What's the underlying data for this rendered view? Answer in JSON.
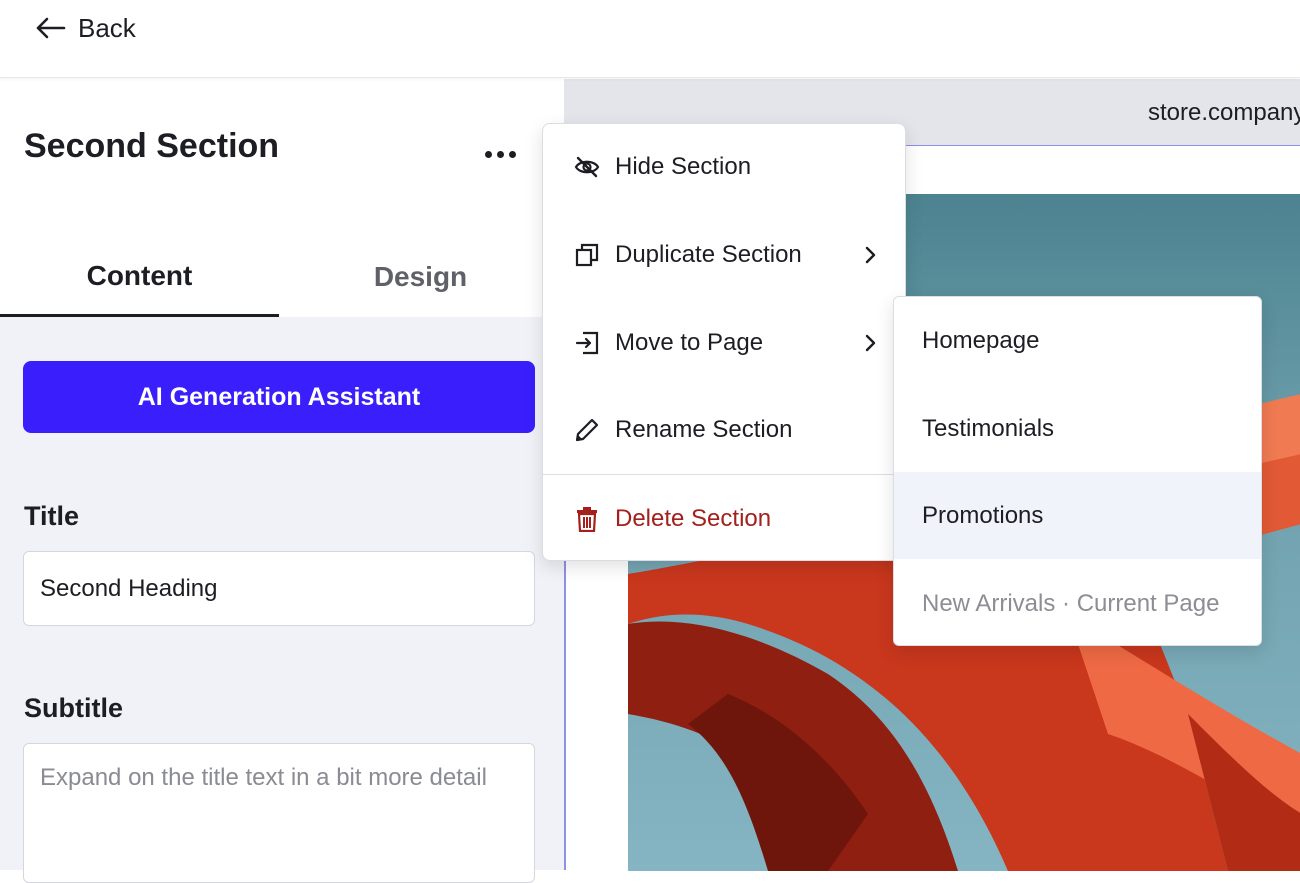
{
  "topbar": {
    "back_label": "Back"
  },
  "panel": {
    "section_title": "Second Section",
    "tabs": [
      {
        "label": "Content",
        "active": true
      },
      {
        "label": "Design",
        "active": false
      }
    ],
    "ai_button_label": "AI Generation Assistant",
    "title_label": "Title",
    "title_value": "Second Heading",
    "subtitle_label": "Subtitle",
    "subtitle_placeholder": "Expand on the title text in a bit more detail"
  },
  "preview": {
    "url": "store.company.com"
  },
  "menu": {
    "items": [
      {
        "label": "Hide Section",
        "icon": "eye-off-icon"
      },
      {
        "label": "Duplicate Section",
        "icon": "duplicate-icon",
        "has_submenu": true
      },
      {
        "label": "Move to Page",
        "icon": "move-to-page-icon",
        "has_submenu": true
      },
      {
        "label": "Rename Section",
        "icon": "pencil-icon"
      },
      {
        "label": "Delete Section",
        "icon": "trash-icon",
        "danger": true
      }
    ]
  },
  "submenu": {
    "items": [
      {
        "label": "Homepage"
      },
      {
        "label": "Testimonials"
      },
      {
        "label": "Promotions",
        "highlighted": true
      },
      {
        "label": "New Arrivals · Current Page",
        "disabled": true
      }
    ]
  },
  "colors": {
    "accent": "#3a1efc",
    "danger": "#a3201c",
    "panel_bg": "#f1f2f7",
    "canvas_bg": "#e4e5ea"
  }
}
